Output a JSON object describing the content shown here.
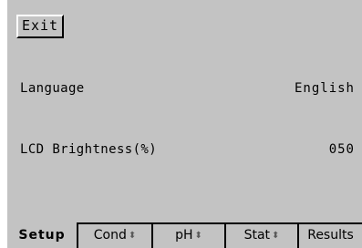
{
  "header": {
    "exit_label": "Exit"
  },
  "settings": {
    "language": {
      "label": "Language",
      "value": "English"
    },
    "brightness": {
      "label": "LCD Brightness(%)",
      "value": "050"
    }
  },
  "tabs": {
    "setup": "Setup",
    "cond": "Cond",
    "ph": "pH",
    "stat": "Stat",
    "results": "Results",
    "scroll_arrow": "⬍"
  },
  "active_tab": "Setup",
  "colors": {
    "screen_background": "#c3c3c3",
    "text": "#000000",
    "arrow": "#5a5a5a"
  }
}
